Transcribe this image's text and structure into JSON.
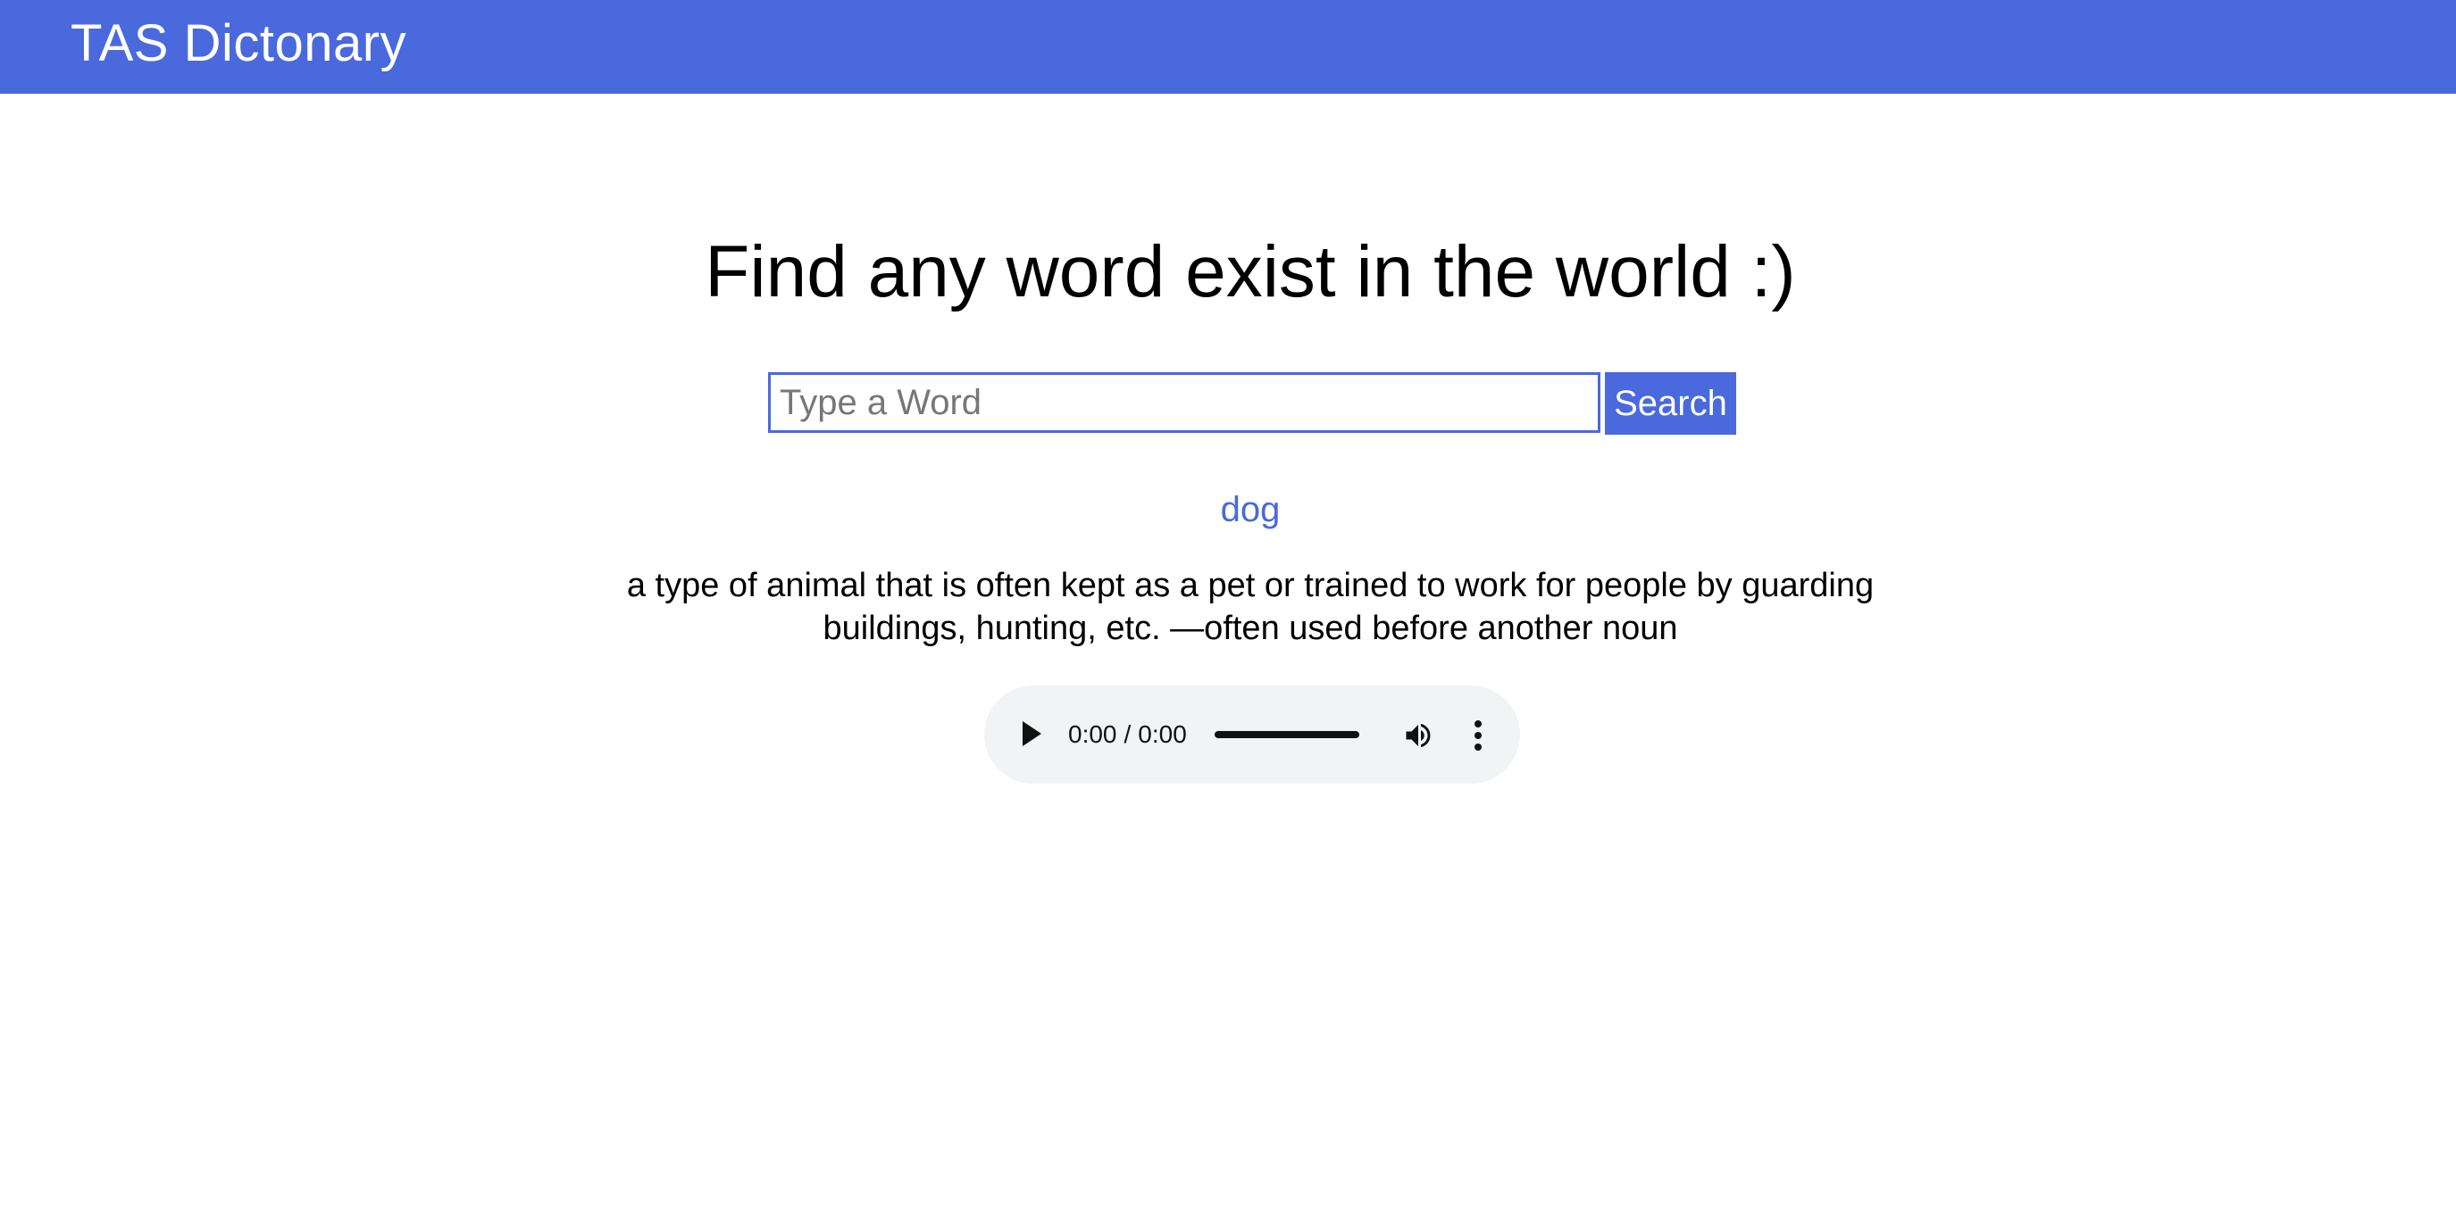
{
  "navbar": {
    "brand": "TAS Dictonary",
    "color": "#4a69dc"
  },
  "main": {
    "headline": "Find any word exist in the world :)"
  },
  "search": {
    "placeholder": "Type a Word",
    "value": "",
    "button_label": "Search"
  },
  "result": {
    "word": "dog",
    "definition": "a type of animal that is often kept as a pet or trained to work for people by guarding buildings, hunting, etc. —often used before another noun"
  },
  "audio": {
    "current_time": "0:00",
    "separator": "/",
    "duration": "0:00",
    "play_icon": "play-icon",
    "volume_icon": "volume-icon",
    "menu_icon": "more-vert-icon"
  }
}
